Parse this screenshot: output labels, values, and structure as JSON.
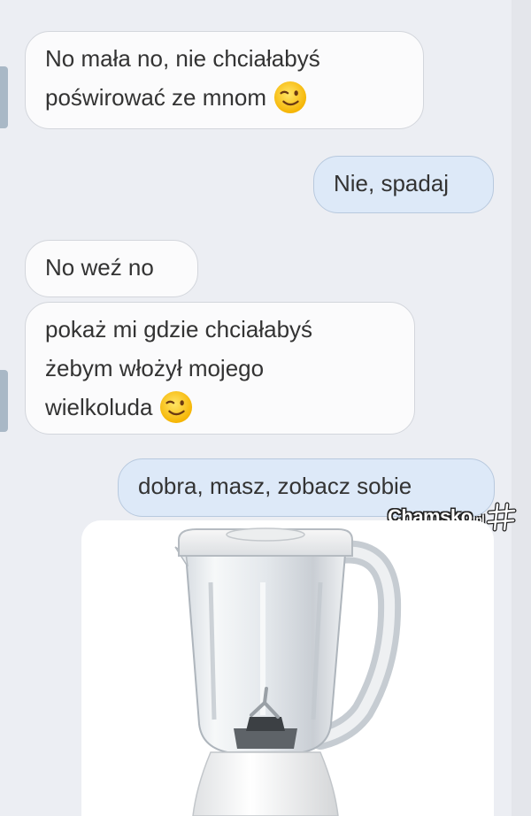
{
  "conversation": {
    "messages": [
      {
        "side": "received",
        "lines": [
          "No mała no, nie chciałabyś",
          "poświrować ze mnom"
        ],
        "emoji": "winking-face"
      },
      {
        "side": "sent",
        "lines": [
          "Nie, spadaj"
        ]
      },
      {
        "side": "received",
        "lines": [
          "No weź no"
        ]
      },
      {
        "side": "received",
        "lines": [
          "pokaż mi gdzie chciałabyś",
          "żebym włożył mojego",
          "wielkoluda"
        ],
        "emoji": "winking-face"
      },
      {
        "side": "sent",
        "lines": [
          "dobra, masz, zobacz sobie"
        ]
      },
      {
        "side": "sent",
        "type": "image",
        "image": "blender-photo"
      }
    ]
  },
  "watermark": {
    "brand": "Chamsko",
    "tld": ".pl",
    "icon": "hash-star-icon"
  },
  "colors": {
    "background": "#eceef3",
    "received_bubble": "#fbfbfc",
    "sent_bubble": "#dde9f8",
    "text": "#333333"
  }
}
